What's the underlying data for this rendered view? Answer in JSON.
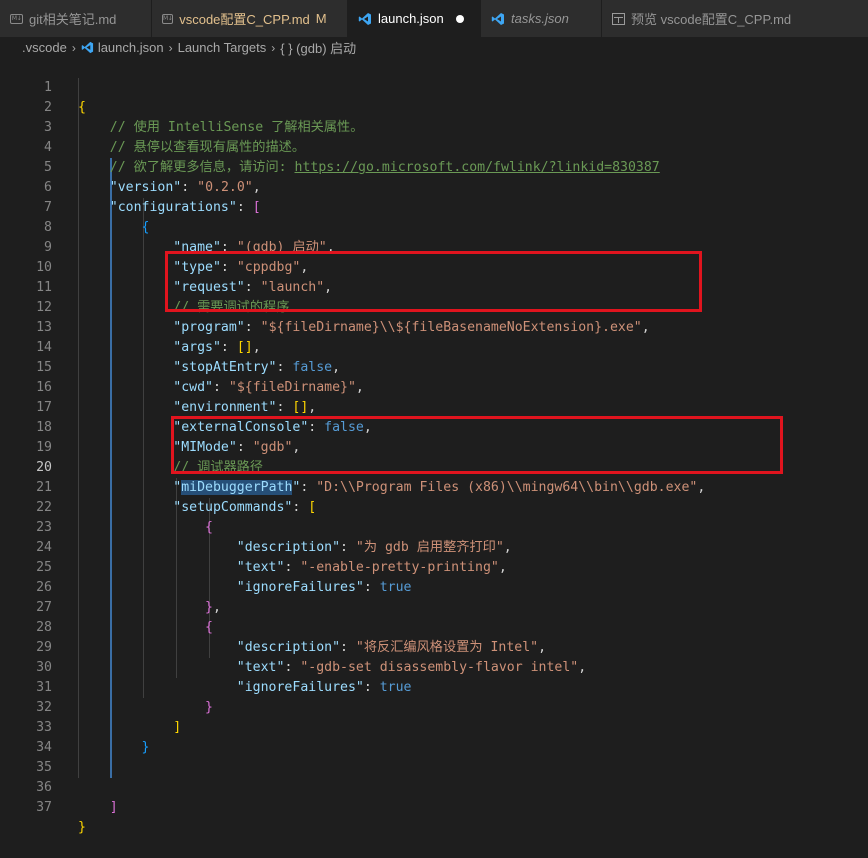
{
  "tabs": [
    {
      "icon": "markdown-icon",
      "label": "git相关笔记.md",
      "active": false
    },
    {
      "icon": "markdown-icon",
      "label": "vscode配置C_CPP.md",
      "status": "M",
      "dirty": true,
      "active": false
    },
    {
      "icon": "vscode-icon",
      "label": "launch.json",
      "dirty": true,
      "active": true
    },
    {
      "icon": "vscode-icon",
      "label": "tasks.json",
      "active": false
    },
    {
      "icon": "preview-icon",
      "label": "预览 vscode配置C_CPP.md",
      "active": false
    }
  ],
  "breadcrumb": [
    ".vscode",
    "launch.json",
    "Launch Targets",
    "{ } (gdb) 启动"
  ],
  "editor": {
    "current_line": 20,
    "lines": [
      {
        "n": "1"
      },
      {
        "n": "2"
      },
      {
        "n": "3"
      },
      {
        "n": "4"
      },
      {
        "n": "5"
      },
      {
        "n": "6"
      },
      {
        "n": "7"
      },
      {
        "n": "8"
      },
      {
        "n": "9"
      },
      {
        "n": "10"
      },
      {
        "n": "11"
      },
      {
        "n": "12"
      },
      {
        "n": "13"
      },
      {
        "n": "14"
      },
      {
        "n": "15"
      },
      {
        "n": "16"
      },
      {
        "n": "17"
      },
      {
        "n": "18"
      },
      {
        "n": "19"
      },
      {
        "n": "20"
      },
      {
        "n": "21"
      },
      {
        "n": "22"
      },
      {
        "n": "23"
      },
      {
        "n": "24"
      },
      {
        "n": "25"
      },
      {
        "n": "26"
      },
      {
        "n": "27"
      },
      {
        "n": "28"
      },
      {
        "n": "29"
      },
      {
        "n": "30"
      },
      {
        "n": "31"
      },
      {
        "n": "32"
      },
      {
        "n": "33"
      },
      {
        "n": "34"
      },
      {
        "n": "35"
      },
      {
        "n": "36"
      },
      {
        "n": "37"
      }
    ],
    "text": {
      "c1": "// 使用 IntelliSense 了解相关属性。",
      "c2": "// 悬停以查看现有属性的描述。",
      "c3_pre": "// 欲了解更多信息，请访问: ",
      "c3_link": "https://go.microsoft.com/fwlink/?linkid=830387",
      "version_key": "\"version\"",
      "version_val": "\"0.2.0\"",
      "configurations_key": "\"configurations\"",
      "name_key": "\"name\"",
      "name_val": "\"(gdb) 启动\"",
      "type_key": "\"type\"",
      "type_val": "\"cppdbg\"",
      "request_key": "\"request\"",
      "request_val": "\"launch\"",
      "c_program": "// 需要调试的程序",
      "program_key": "\"program\"",
      "program_val": "\"${fileDirname}\\\\${fileBasenameNoExtension}.exe\"",
      "args_key": "\"args\"",
      "stopAtEntry_key": "\"stopAtEntry\"",
      "false1": "false",
      "cwd_key": "\"cwd\"",
      "cwd_val": "\"${fileDirname}\"",
      "environment_key": "\"environment\"",
      "externalConsole_key": "\"externalConsole\"",
      "false2": "false",
      "MIMode_key": "\"MIMode\"",
      "MIMode_val": "\"gdb\"",
      "c_debugger": "// 调试器路径",
      "q_open": "\"",
      "miDebuggerPath_word": "miDebuggerPath",
      "q_close": "\"",
      "miDebuggerPath_val": "\"D:\\\\Program Files (x86)\\\\mingw64\\\\bin\\\\gdb.exe\"",
      "setupCommands_key": "\"setupCommands\"",
      "description_key": "\"description\"",
      "desc1_val": "\"为 gdb 启用整齐打印\"",
      "text_key": "\"text\"",
      "text1_val": "\"-enable-pretty-printing\"",
      "ignoreFailures_key": "\"ignoreFailures\"",
      "true_val": "true",
      "desc2_val": "\"将反汇编风格设置为 Intel\"",
      "text2_val": "\"-gdb-set disassembly-flavor intel\""
    }
  },
  "colors": {
    "background": "#1e1e1e",
    "key": "#9cdcfe",
    "string": "#ce9178",
    "comment": "#6a9955",
    "keyword": "#569cd6",
    "annotation_box": "#e0141e"
  }
}
